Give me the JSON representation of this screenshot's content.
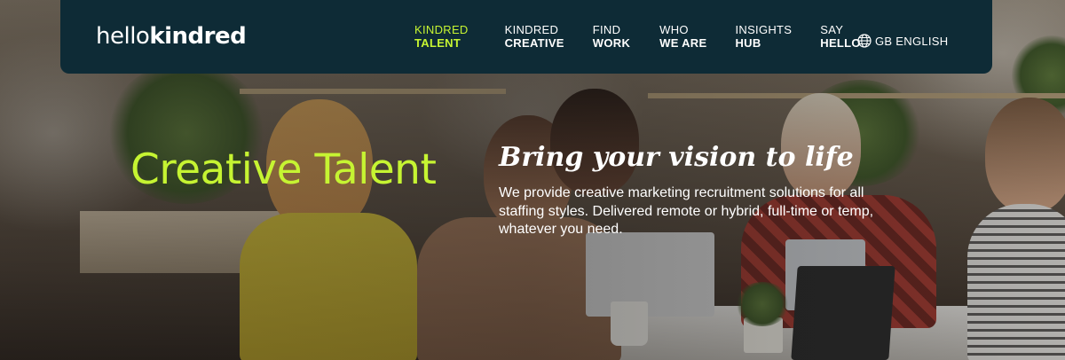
{
  "header": {
    "logo_light": "hello",
    "logo_bold": "kindred",
    "background_color": "#0e2b36",
    "accent_color": "#c6f432",
    "nav": [
      {
        "top": "KINDRED",
        "bottom": "TALENT",
        "active": true
      },
      {
        "top": "KINDRED",
        "bottom": "CREATIVE",
        "active": false
      },
      {
        "top": "FIND",
        "bottom": "WORK",
        "active": false
      },
      {
        "top": "WHO",
        "bottom": "WE ARE",
        "active": false
      },
      {
        "top": "INSIGHTS",
        "bottom": "HUB",
        "active": false
      },
      {
        "top": "SAY",
        "bottom": "HELLO",
        "active": false
      }
    ],
    "language": {
      "icon": "globe-icon",
      "label": "GB ENGLISH"
    }
  },
  "hero": {
    "title": "Creative Talent",
    "heading": "Bring your vision to life",
    "copy": "We provide creative marketing recruitment solutions for all staffing styles. Delivered remote or hybrid, full-time or temp, whatever you need.",
    "background_image": "office-team-photo"
  }
}
